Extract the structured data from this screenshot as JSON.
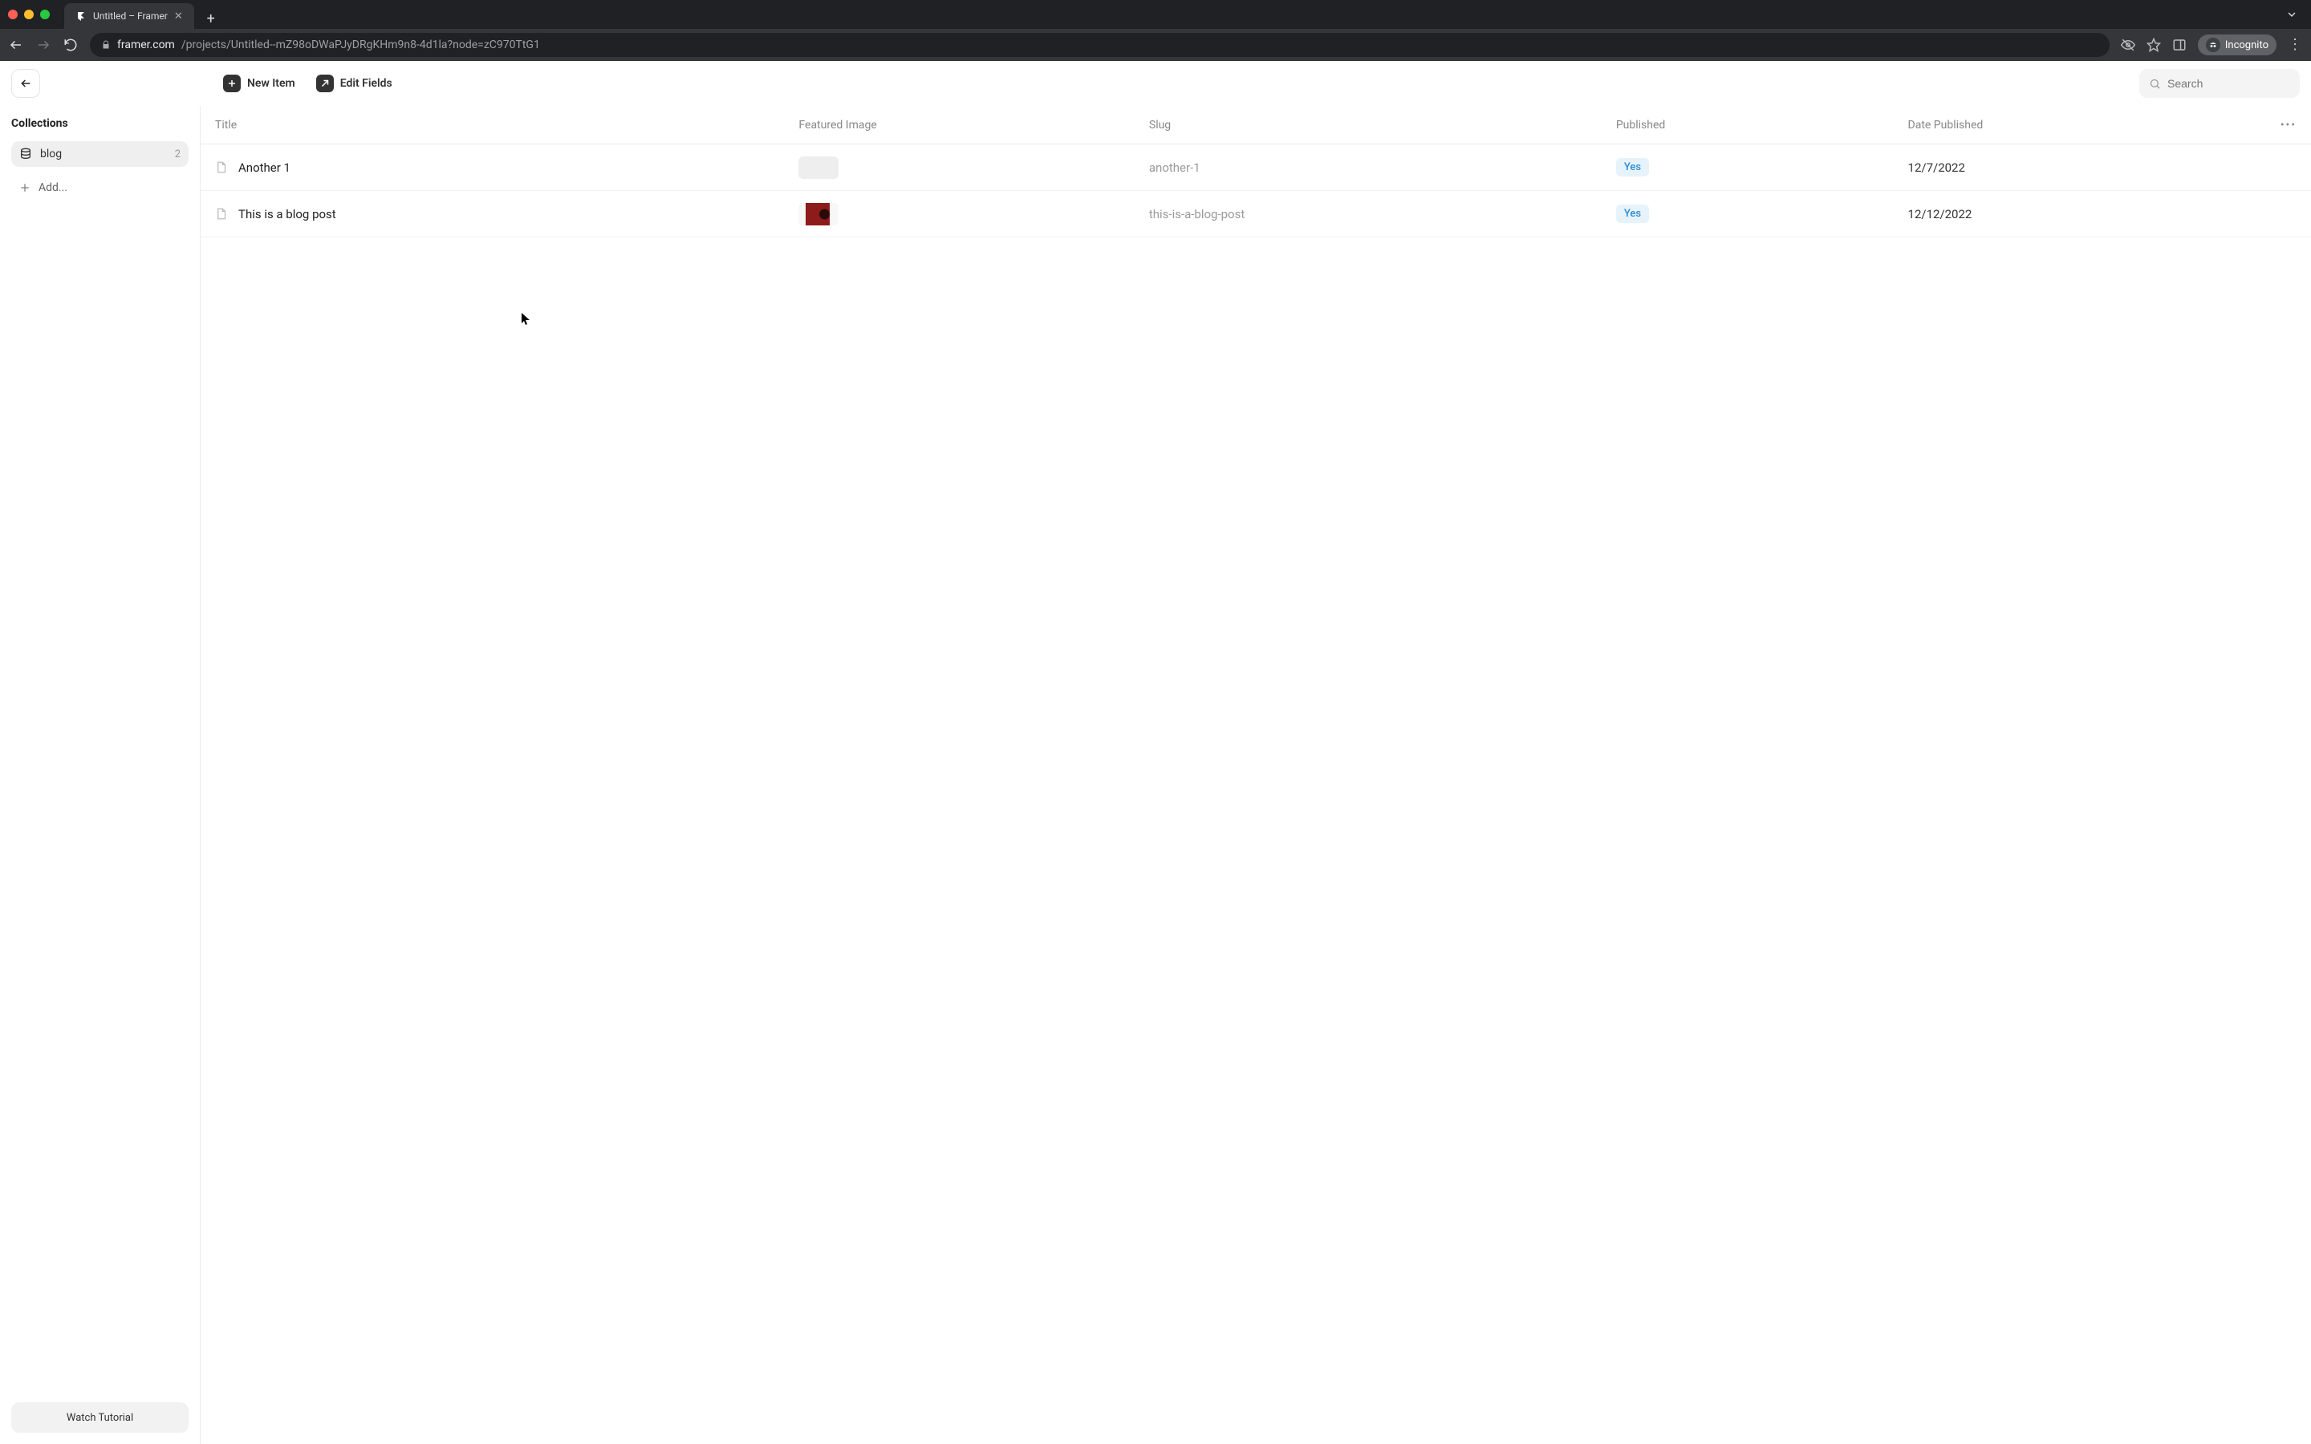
{
  "browser": {
    "tab_title": "Untitled – Framer",
    "url_host": "framer.com",
    "url_path": "/projects/Untitled--mZ98oDWaPJyDRgKHm9n8-4d1la?node=zC970TtG1",
    "incognito_label": "Incognito"
  },
  "toolbar": {
    "new_item_label": "New Item",
    "edit_fields_label": "Edit Fields",
    "search_placeholder": "Search"
  },
  "sidebar": {
    "heading": "Collections",
    "items": [
      {
        "name": "blog",
        "count": "2"
      }
    ],
    "add_label": "Add...",
    "tutorial_label": "Watch Tutorial"
  },
  "table": {
    "columns": {
      "title": "Title",
      "featured": "Featured Image",
      "slug": "Slug",
      "published": "Published",
      "date": "Date Published"
    },
    "rows": [
      {
        "title": "Another 1",
        "has_image": false,
        "slug": "another-1",
        "published_label": "Yes",
        "date": "12/7/2022"
      },
      {
        "title": "This is a blog post",
        "has_image": true,
        "slug": "this-is-a-blog-post",
        "published_label": "Yes",
        "date": "12/12/2022"
      }
    ]
  }
}
